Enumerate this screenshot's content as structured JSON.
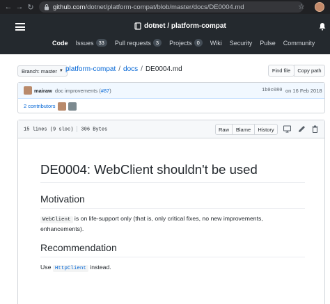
{
  "browser": {
    "url_host": "github.com",
    "url_path": "/dotnet/platform-compat/blob/master/docs/DE0004.md",
    "back_icon": "arrow-left",
    "forward_icon": "arrow-right",
    "reload_icon": "reload",
    "star_icon": "star"
  },
  "header": {
    "owner": "dotnet",
    "separator": " / ",
    "repo": "platform-compat",
    "nav": [
      {
        "label": "Code",
        "active": true
      },
      {
        "label": "Issues",
        "count": "33"
      },
      {
        "label": "Pull requests",
        "count": "3"
      },
      {
        "label": "Projects",
        "count": "0"
      },
      {
        "label": "Wiki"
      },
      {
        "label": "Security"
      },
      {
        "label": "Pulse"
      },
      {
        "label": "Community"
      }
    ]
  },
  "breadcrumb": {
    "branch_label": "Branch: master",
    "repo_link": "platform-compat",
    "sep": "/",
    "folder_link": "docs",
    "file": "DE0004.md",
    "find_file": "Find file",
    "copy_path": "Copy path"
  },
  "commit": {
    "author": "mairaw",
    "message": "doc improvements (",
    "pr_link": "#87",
    "message_end": ")",
    "sha": "1b0c080",
    "date": "on 16 Feb 2018",
    "contributors": "2 contributors"
  },
  "file": {
    "lines": "15 lines (9 sloc)",
    "size": "306 Bytes",
    "raw": "Raw",
    "blame": "Blame",
    "history": "History"
  },
  "markdown": {
    "h1": "DE0004: WebClient shouldn't be used",
    "h2_motivation": "Motivation",
    "p1_code": "WebClient",
    "p1_text": " is on life-support only (that is, only critical fixes, no new improvements, enhancements).",
    "h2_recommendation": "Recommendation",
    "p2_prefix": "Use ",
    "p2_code": "HttpClient",
    "p2_suffix": " instead."
  },
  "colors": {
    "header_bg": "#24292e",
    "link": "#0366d6",
    "commit_bg": "#f1f8ff"
  }
}
